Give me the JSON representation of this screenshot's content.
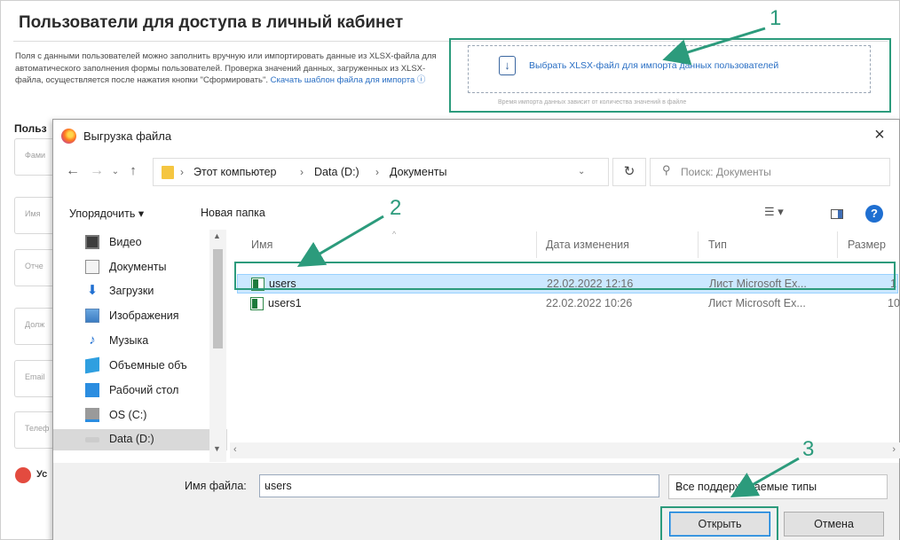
{
  "background_page": {
    "title": "Пользователи для доступа в личный кабинет",
    "description": "Поля с данными пользователей можно заполнить вручную или импортировать данные из XLSX-файла для автоматического заполнения формы пользователей. Проверка значений данных, загруженных из XLSX-файла, осуществляется после нажатия кнопки \"Сформировать\".",
    "template_link": "Скачать шаблон файла для импорта",
    "import_button": "Выбрать XLSX-файл для импорта данных пользователей",
    "import_note": "Время импорта данных зависит от количества значений в файле",
    "users_heading": "Польз",
    "fields": [
      "Фами",
      "Имя",
      "Отче",
      "Долж",
      "Email",
      "Телеф"
    ],
    "left_bottom_label": "Ус"
  },
  "dialog": {
    "title": "Выгрузка файла",
    "close_symbol": "×",
    "breadcrumbs": [
      "Этот компьютер",
      "Data (D:)",
      "Документы"
    ],
    "search_placeholder": "Поиск: Документы",
    "toolbar": {
      "organize": "Упорядочить ▾",
      "new_folder": "Новая папка"
    },
    "nav_items": [
      {
        "label": "Видео",
        "icon": "video-icon"
      },
      {
        "label": "Документы",
        "icon": "documents-icon"
      },
      {
        "label": "Загрузки",
        "icon": "downloads-icon"
      },
      {
        "label": "Изображения",
        "icon": "pictures-icon"
      },
      {
        "label": "Музыка",
        "icon": "music-icon"
      },
      {
        "label": "Объемные объ",
        "icon": "3d-objects-icon"
      },
      {
        "label": "Рабочий стол",
        "icon": "desktop-icon"
      },
      {
        "label": "OS (C:)",
        "icon": "drive-c-icon"
      },
      {
        "label": "Data (D:)",
        "icon": "drive-d-icon",
        "selected": true
      }
    ],
    "columns": [
      "Имя",
      "Дата изменения",
      "Тип",
      "Размер"
    ],
    "files": [
      {
        "name": "users",
        "modified": "22.02.2022 12:16",
        "type": "Лист Microsoft Ex...",
        "size": "1",
        "selected": true
      },
      {
        "name": "users1",
        "modified": "22.02.2022 10:26",
        "type": "Лист Microsoft Ex...",
        "size": "10",
        "selected": false
      }
    ],
    "filename_label": "Имя файла:",
    "filename_value": "users",
    "filetype_value": "Все поддерживаемые типы",
    "open_button": "Открыть",
    "cancel_button": "Отмена"
  },
  "annotations": {
    "steps": [
      "1",
      "2",
      "3"
    ],
    "color": "#2c9b7c"
  },
  "colors": {
    "accent_green": "#2c9b7c",
    "link_blue": "#2a6fc4",
    "selection_blue": "#cce8ff"
  }
}
